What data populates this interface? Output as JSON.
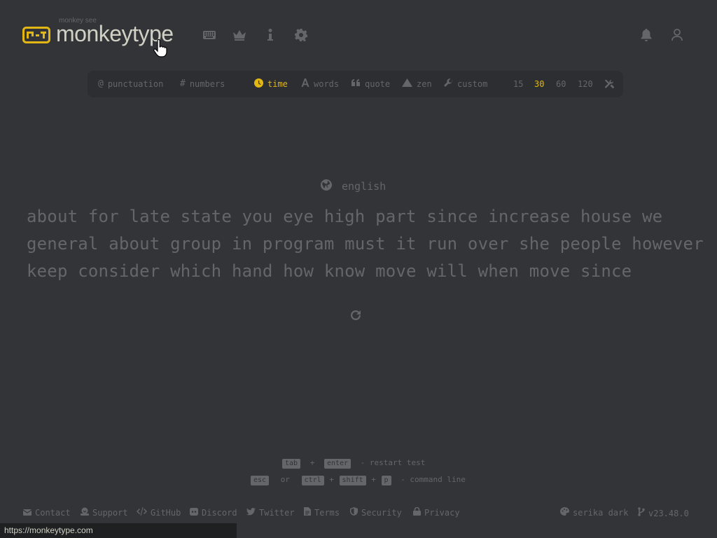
{
  "header": {
    "logo_top": "monkey see",
    "logo_text": "monkeytype",
    "nav": [
      "keyboard-icon",
      "crown-icon",
      "info-icon",
      "gear-icon"
    ],
    "right": [
      "bell-icon",
      "user-icon"
    ]
  },
  "config": {
    "punctuation": "punctuation",
    "numbers": "numbers",
    "modes": {
      "time": "time",
      "words": "words",
      "quote": "quote",
      "zen": "zen",
      "custom": "custom"
    },
    "active_mode": "time",
    "durations": [
      "15",
      "30",
      "60",
      "120"
    ],
    "active_duration": "30"
  },
  "test": {
    "language": "english",
    "lines": [
      "about for late state you eye high part since increase house we",
      "general about group in program must it run over she people however",
      "keep consider which hand how know move will when move since"
    ]
  },
  "hints": {
    "tab": "tab",
    "plus": "+",
    "enter": "enter",
    "restart": "- restart test",
    "esc": "esc",
    "or": "or",
    "ctrl": "ctrl",
    "shift": "shift",
    "p": "p",
    "command": "- command line"
  },
  "footer": {
    "contact": "Contact",
    "support": "Support",
    "github": "GitHub",
    "discord": "Discord",
    "twitter": "Twitter",
    "terms": "Terms",
    "security": "Security",
    "privacy": "Privacy",
    "theme": "serika dark",
    "version": "v23.48.0"
  },
  "status_url": "https://monkeytype.com",
  "colors": {
    "bg": "#323437",
    "sub": "#646669",
    "text": "#d1d0c5",
    "main": "#e2b714",
    "sub_alt": "#2c2e31"
  }
}
